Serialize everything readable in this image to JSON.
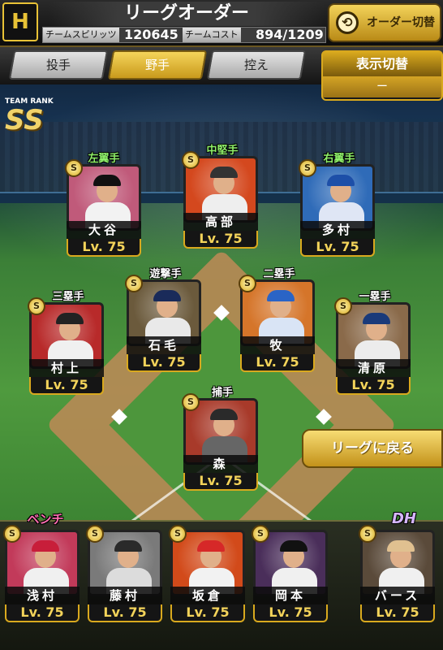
{
  "header": {
    "team_logo": "H",
    "title": "リーグオーダー",
    "spirits_label": "チームスピリッツ",
    "spirits_value": "120645",
    "cost_label": "チームコスト",
    "cost_value": "894/1209",
    "order_switch_label": "オーダー切替"
  },
  "tabs": [
    {
      "label": "投手",
      "active": false
    },
    {
      "label": "野手",
      "active": true
    },
    {
      "label": "控え",
      "active": false
    }
  ],
  "display_toggle": {
    "label": "表示切替",
    "value": "ー"
  },
  "team_rank": {
    "caption": "TEAM RANK",
    "value": "SS"
  },
  "badge_text": "S",
  "positions": {
    "lf": {
      "label": "左翼手",
      "name": "大谷",
      "level": "Lv. 75",
      "colors": {
        "bg": "#c05a7a",
        "cap": "#111111",
        "body": "#f2f2f2"
      }
    },
    "cf": {
      "label": "中堅手",
      "name": "高部",
      "level": "Lv. 75",
      "colors": {
        "bg": "#d4481e",
        "cap": "#333333",
        "body": "#eeeeee"
      }
    },
    "rf": {
      "label": "右翼手",
      "name": "多村",
      "level": "Lv. 75",
      "colors": {
        "bg": "#2f6bb8",
        "cap": "#1d4fa8",
        "body": "#dfe6f5"
      }
    },
    "ss": {
      "label": "遊撃手",
      "name": "石毛",
      "level": "Lv. 75",
      "colors": {
        "bg": "#6b5a3c",
        "cap": "#1a2b5a",
        "body": "#e9e9e9"
      }
    },
    "b2": {
      "label": "二塁手",
      "name": "牧",
      "level": "Lv. 75",
      "colors": {
        "bg": "#d5752a",
        "cap": "#2a64c6",
        "body": "#d9e4f5"
      }
    },
    "b3": {
      "label": "三塁手",
      "name": "村上",
      "level": "Lv. 75",
      "colors": {
        "bg": "#b82a2a",
        "cap": "#222222",
        "body": "#f0f0f0"
      }
    },
    "b1": {
      "label": "一塁手",
      "name": "清原",
      "level": "Lv. 75",
      "colors": {
        "bg": "#8a6a4a",
        "cap": "#1a3a7a",
        "body": "#ececec"
      }
    },
    "c": {
      "label": "捕手",
      "name": "森",
      "level": "Lv. 75",
      "colors": {
        "bg": "#a83a2a",
        "cap": "#2a2a2a",
        "body": "#666666"
      }
    }
  },
  "back_league_label": "リーグに戻る",
  "bench": {
    "label": "ベンチ",
    "players": [
      {
        "name": "浅村",
        "level": "Lv. 75",
        "colors": {
          "bg": "#c23a5a",
          "cap": "#c81e3a",
          "body": "#f0f0f0"
        }
      },
      {
        "name": "藤村",
        "level": "Lv. 75",
        "colors": {
          "bg": "#7a7a7a",
          "cap": "#2a2a2a",
          "body": "#dcdcdc"
        }
      },
      {
        "name": "坂倉",
        "level": "Lv. 75",
        "colors": {
          "bg": "#d24a1a",
          "cap": "#d62828",
          "body": "#f2f2f2"
        }
      },
      {
        "name": "岡本",
        "level": "Lv. 75",
        "colors": {
          "bg": "#4a2e5a",
          "cap": "#111111",
          "body": "#f0f0f0"
        }
      }
    ]
  },
  "dh": {
    "label": "DH",
    "name": "バース",
    "level": "Lv. 75",
    "colors": {
      "bg": "#5a4a3a",
      "cap": "#e0c090",
      "body": "#f0f0f0"
    }
  }
}
